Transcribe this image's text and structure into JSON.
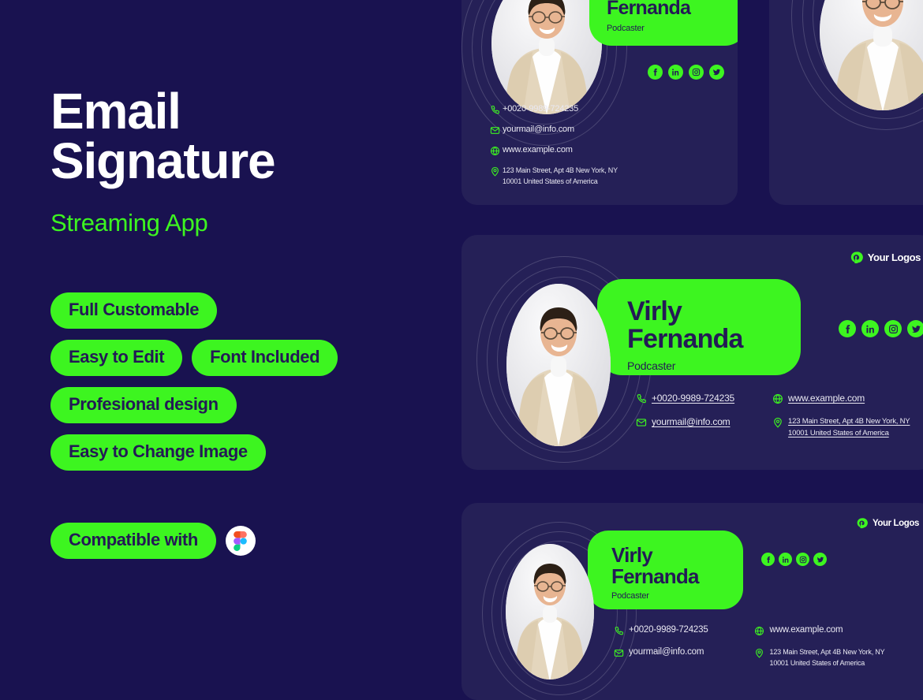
{
  "hero": {
    "title_line1": "Email",
    "title_line2": "Signature",
    "subtitle": "Streaming App"
  },
  "features": {
    "rows": [
      [
        "Full Customable"
      ],
      [
        "Easy to Edit",
        "Font Included"
      ],
      [
        "Profesional design"
      ],
      [
        "Easy to Change Image"
      ]
    ]
  },
  "compatibility": {
    "label": "Compatible with",
    "tool": "figma-logo"
  },
  "signature": {
    "first_name": "Virly",
    "last_name": "Fernanda",
    "role": "Podcaster",
    "logo_text": "Your Logos",
    "contacts": {
      "phone": "+0020-9989-724235",
      "email": "yourmail@info.com",
      "website": "www.example.com",
      "address_line1": "123 Main Street, Apt 4B New York, NY",
      "address_line2": "10001 United States of America"
    },
    "socials": [
      "facebook-icon",
      "linkedin-icon",
      "instagram-icon",
      "twitter-icon"
    ]
  },
  "colors": {
    "background": "#191250",
    "card": "#252057",
    "accent_green": "#3DF520",
    "text_light": "#e9e8f2",
    "text_dark": "#231a55"
  }
}
